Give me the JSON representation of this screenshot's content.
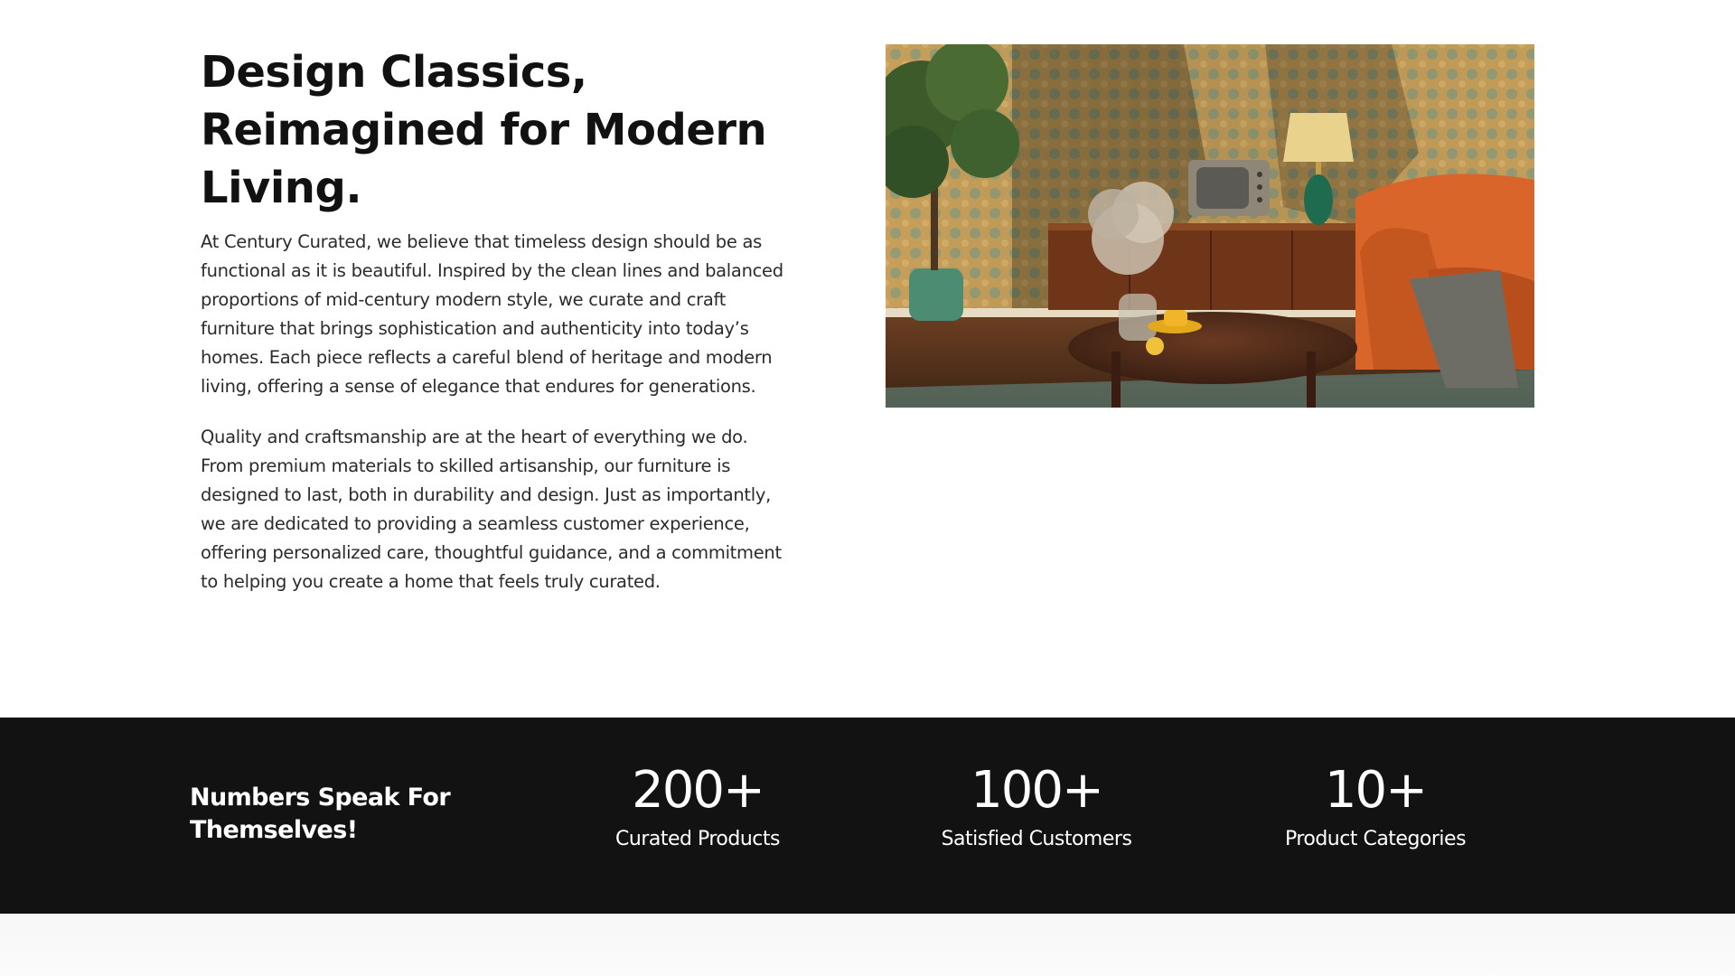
{
  "about": {
    "title": "Design Classics, Reimagined for Modern Living.",
    "paragraphs": [
      "At Century Curated, we believe that timeless design should be as functional as it is beautiful. Inspired by the clean lines and balanced proportions of mid-century modern style, we curate and craft furniture that brings sophistication and authenticity into today’s homes. Each piece reflects a careful blend of heritage and modern living, offering a sense of elegance that endures for generations.",
      "Quality and craftsmanship are at the heart of everything we do. From premium materials to skilled artisanship, our furniture is designed to last, both in durability and design. Just as importantly, we are dedicated to providing a seamless customer experience, offering personalized care, thoughtful guidance, and a commitment to helping you create a home that feels truly curated."
    ]
  },
  "stats": {
    "heading": "Numbers Speak For Themselves!",
    "items": [
      {
        "number": "200+",
        "label": "Curated Products"
      },
      {
        "number": "100+",
        "label": "Satisfied Customers"
      },
      {
        "number": "10+",
        "label": "Product Categories"
      }
    ]
  },
  "colors": {
    "background": "#ffffff",
    "stats_band": "#121212",
    "text_dark": "#111111",
    "text_light": "#ffffff"
  }
}
